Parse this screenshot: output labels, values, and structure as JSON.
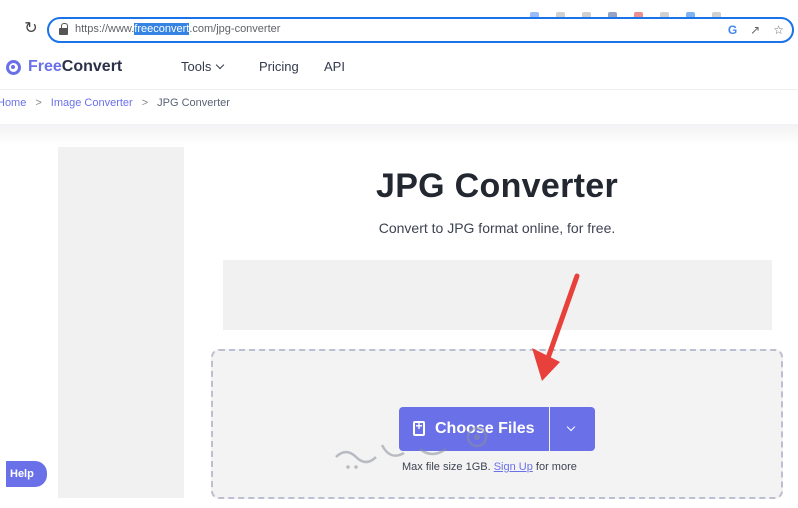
{
  "browser": {
    "url_prefix": "https://www.",
    "url_highlight": "freeconvert",
    "url_suffix": ".com/jpg-converter",
    "url_icons": [
      "google-icon",
      "share-icon",
      "star-icon"
    ]
  },
  "nav": {
    "logo_part1": "Free",
    "logo_part2": "Convert",
    "items": [
      {
        "label": "Tools"
      },
      {
        "label": "Pricing"
      },
      {
        "label": "API"
      }
    ]
  },
  "breadcrumb": {
    "items": [
      "Home",
      "Image Converter",
      "JPG Converter"
    ],
    "separator": ">"
  },
  "main": {
    "title": "JPG Converter",
    "subtitle": "Convert to JPG format online, for free."
  },
  "upload": {
    "button_label": "Choose Files",
    "note_prefix": "Max file size 1GB.",
    "note_link": "Sign Up",
    "note_suffix": "for more"
  },
  "help": {
    "label": "Help"
  },
  "colors": {
    "accent": "#6a71e8",
    "arrow": "#e8403a",
    "focus_ring": "#1a73e8"
  }
}
